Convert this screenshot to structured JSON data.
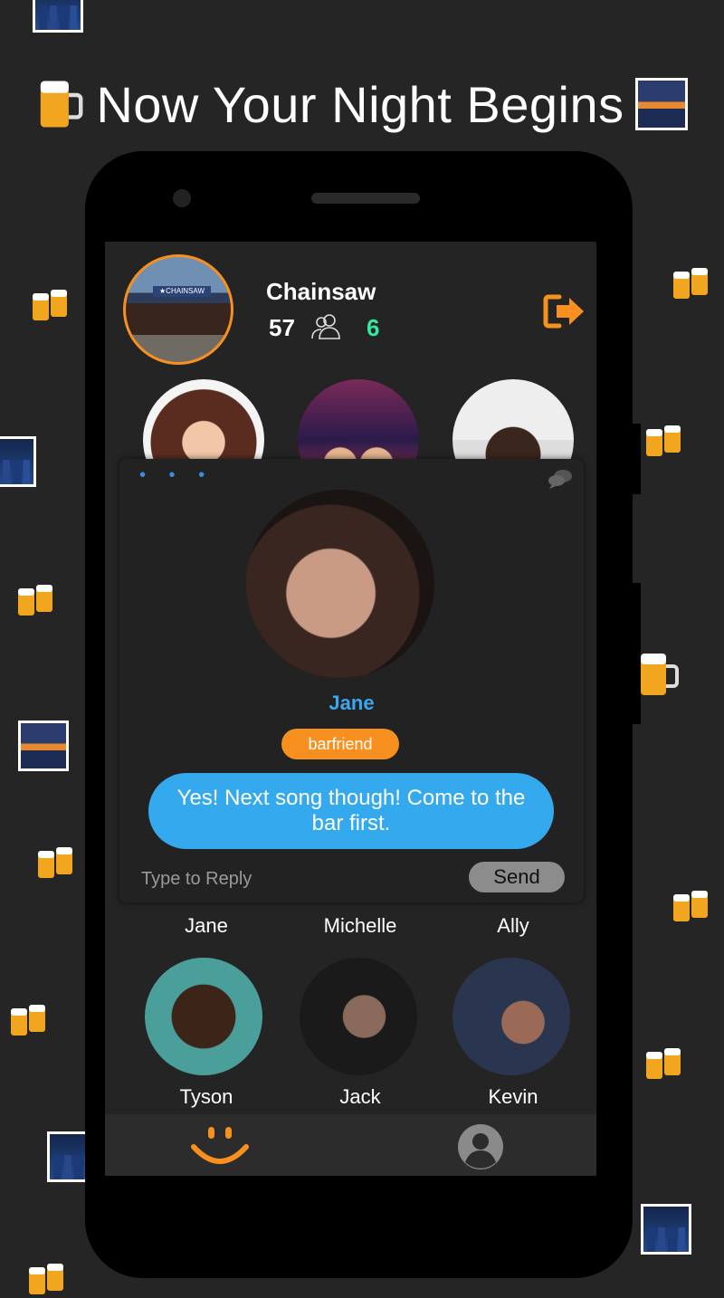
{
  "headline": {
    "text": "Now Your Night Begins"
  },
  "decorations": {
    "beer": "beer-mugs-emoji",
    "night": "night-city-emoji",
    "bridge": "bridge-at-night-emoji"
  },
  "venue": {
    "name": "Chainsaw",
    "sign_text": "★CHAINSAW",
    "checked_in_count": "57",
    "active_count": "6",
    "exit_icon": "exit-icon",
    "people_icon": "people-icon"
  },
  "popup": {
    "dots": "• • •",
    "name": "Jane",
    "tag": "barfriend",
    "message": "Yes! Next song though! Come to the bar first.",
    "reply_placeholder": "Type to Reply",
    "send_label": "Send"
  },
  "people": [
    {
      "name": "Jane"
    },
    {
      "name": "Michelle"
    },
    {
      "name": "Ally"
    },
    {
      "name": "Tyson"
    },
    {
      "name": "Jack"
    },
    {
      "name": "Kevin"
    }
  ],
  "nav": {
    "home_icon": "smiley-icon",
    "profile_icon": "profile-icon"
  },
  "colors": {
    "accent_orange": "#f7901e",
    "accent_blue": "#35a9ee",
    "active_green": "#35e8a0",
    "background": "#252525"
  }
}
